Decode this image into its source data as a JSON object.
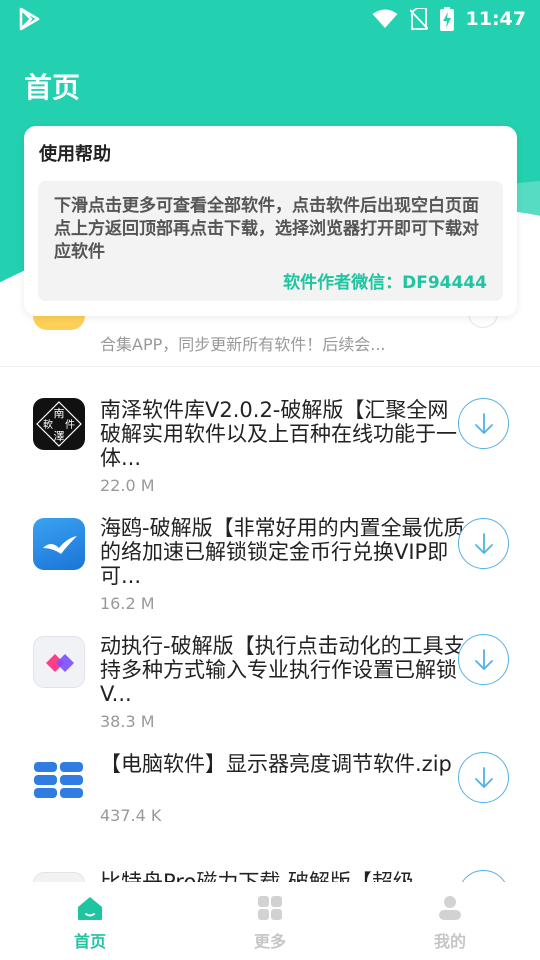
{
  "status_bar": {
    "time": "11:47"
  },
  "page": {
    "title": "首页"
  },
  "help": {
    "title": "使用帮助",
    "body": "下滑点击更多可查看全部软件，点击软件后出现空白页面点上方返回顶部再点击下载，选择浏览器打开即可下载对应软件",
    "contact": "软件作者微信：DF94444"
  },
  "partial_item": {
    "desc": "合集APP，同步更新所有软件！后续会..."
  },
  "apps": [
    {
      "name": "南泽软件库V2.0.2-破解版【汇聚全网破解实用软件以及上百种在线功能于一体...",
      "size": "22.0 M",
      "icon": "nanze-logo-icon"
    },
    {
      "name": "海鸥-破解版【非常好用的内置全最优质的络加速已解锁锁定金币行兑换VIP即可...",
      "size": "16.2 M",
      "icon": "seagull-icon"
    },
    {
      "name": "动执行-破解版【执行点击动化的工具支持多种方式输入专业执行作设置已解锁V...",
      "size": "38.3 M",
      "icon": "diamond-icon"
    },
    {
      "name": "【电脑软件】显示器亮度调节软件.zip",
      "size": "437.4 K",
      "icon": "brightness-app-icon"
    },
    {
      "name": "比特舟Pro磁力下载-破解版【超级",
      "size": "",
      "icon": "app-icon"
    }
  ],
  "tabs": [
    {
      "label": "首页",
      "icon": "home-icon"
    },
    {
      "label": "更多",
      "icon": "grid-icon"
    },
    {
      "label": "我的",
      "icon": "user-icon"
    }
  ],
  "colors": {
    "accent": "#23d0b0",
    "link": "#1fc5a0",
    "download": "#4fb3e6"
  }
}
